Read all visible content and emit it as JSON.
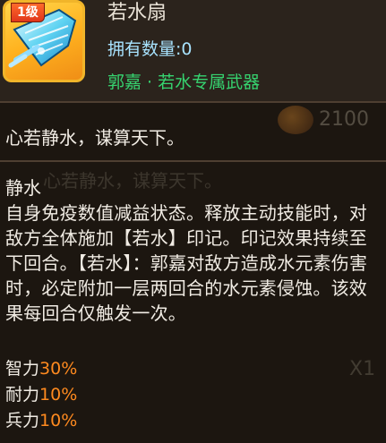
{
  "item": {
    "level": "1级",
    "name": "若水扇",
    "quantity_text": "拥有数量:0",
    "exclusive_text": "郭嘉 · 若水专属武器"
  },
  "description": {
    "quote": "心若静水，谋算天下。",
    "skill_name": "静水",
    "skill_text": "自身免疫数值减益状态。释放主动技能时，对敌方全体施加【若水】印记。印记效果持续至下回合。【若水】：郭嘉对敌方造成水元素伤害时，必定附加一层两回合的水元素侵蚀。该效果每回合仅触发一次。"
  },
  "stats": [
    {
      "label": "智力",
      "value": "30%"
    },
    {
      "label": "耐力",
      "value": "10%"
    },
    {
      "label": "兵力",
      "value": "10%"
    }
  ],
  "background_ui": {
    "coin_value": "2100",
    "quote_ghost": "心若静水，谋算天下。",
    "count_ghost": "X1"
  },
  "colors": {
    "frame_gold": "#f1b52a",
    "quantity_blue": "#a8e3ff",
    "exclusive_green": "#36d36f",
    "stat_orange": "#ff8a1f",
    "level_badge_red": "#e0361b"
  },
  "icons": [
    "fan-weapon-icon",
    "coin-icon"
  ]
}
